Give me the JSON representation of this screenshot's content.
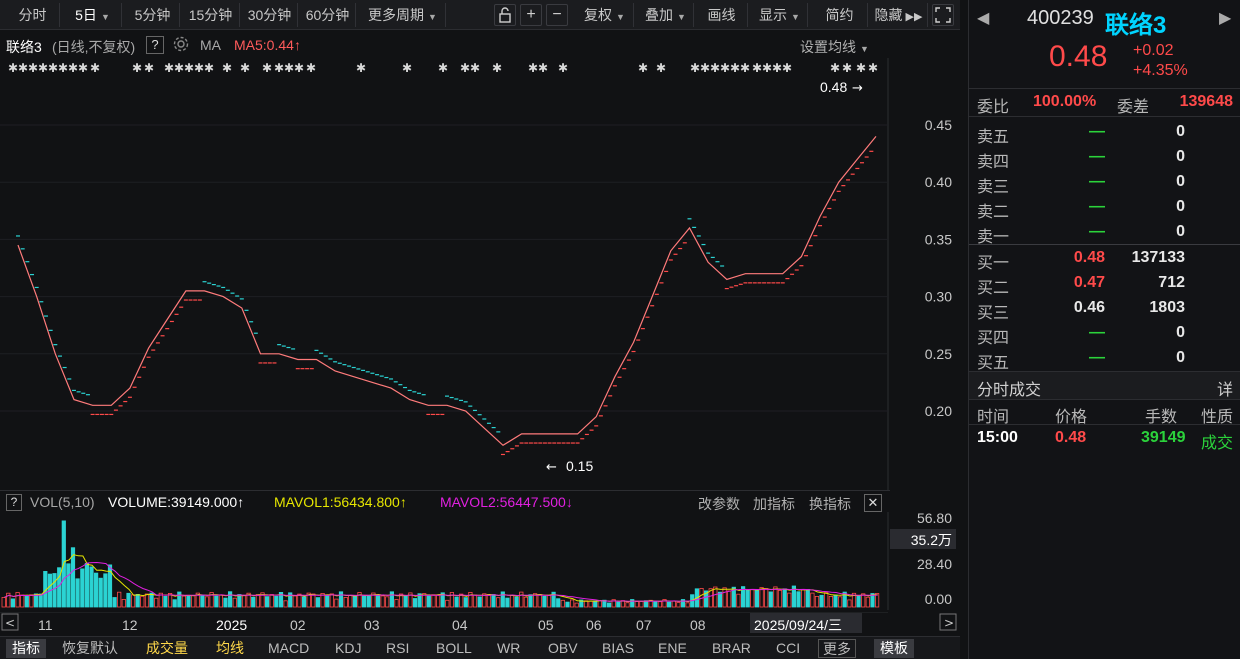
{
  "toolbar": {
    "period_buttons": [
      "分时",
      "5日",
      "5分钟",
      "15分钟",
      "30分钟",
      "60分钟",
      "更多周期"
    ],
    "tools": [
      "复权",
      "叠加",
      "画线",
      "显示",
      "简约",
      "隐藏"
    ]
  },
  "chart_header": {
    "name": "联络3",
    "mode": "(日线,不复权)",
    "help": "?",
    "ma_label": "MA",
    "ma5": "MA5:0.44",
    "settings": "设置均线"
  },
  "price_axis": [
    "0.45",
    "0.40",
    "0.35",
    "0.30",
    "0.25",
    "0.20"
  ],
  "annotations": {
    "high": "0.48",
    "low": "0.15"
  },
  "volume_header": {
    "help": "?",
    "vol": "VOL(5,10)",
    "volume": "VOLUME:39149.000",
    "mavol1": "MAVOL1:56434.800",
    "mavol2": "MAVOL2:56447.500",
    "edit_params": "改参数",
    "add_indicator": "加指标",
    "switch_indicator": "换指标"
  },
  "volume_axis": [
    "56.80",
    "35.2万",
    "28.40",
    "0.00"
  ],
  "time_axis": [
    "11",
    "12",
    "2025",
    "02",
    "03",
    "04",
    "05",
    "06",
    "07",
    "08",
    "2025/09/24/三"
  ],
  "bottom_tabs": [
    "指标",
    "恢复默认",
    "成交量",
    "均线",
    "MACD",
    "KDJ",
    "RSI",
    "BOLL",
    "WR",
    "OBV",
    "BIAS",
    "ENE",
    "BRAR",
    "CCI",
    "更多",
    "模板"
  ],
  "quote": {
    "code": "400239",
    "name": "联络3",
    "price": "0.48",
    "change": "+0.02",
    "change_pct": "+4.35%",
    "weibi_label": "委比",
    "weibi": "100.00%",
    "weicha_label": "委差",
    "weicha": "139648"
  },
  "order_book": {
    "asks": [
      {
        "label": "卖五",
        "price": "—",
        "vol": "0"
      },
      {
        "label": "卖四",
        "price": "—",
        "vol": "0"
      },
      {
        "label": "卖三",
        "price": "—",
        "vol": "0"
      },
      {
        "label": "卖二",
        "price": "—",
        "vol": "0"
      },
      {
        "label": "卖一",
        "price": "—",
        "vol": "0"
      }
    ],
    "bids": [
      {
        "label": "买一",
        "price": "0.48",
        "vol": "137133"
      },
      {
        "label": "买二",
        "price": "0.47",
        "vol": "712"
      },
      {
        "label": "买三",
        "price": "0.46",
        "vol": "1803"
      },
      {
        "label": "买四",
        "price": "—",
        "vol": "0"
      },
      {
        "label": "买五",
        "price": "—",
        "vol": "0"
      }
    ]
  },
  "trades": {
    "title": "分时成交",
    "detail": "详",
    "headers": [
      "时间",
      "价格",
      "手数",
      "性质"
    ],
    "rows": [
      {
        "time": "15:00",
        "price": "0.48",
        "vol": "39149",
        "type": "成交"
      }
    ]
  },
  "colors": {
    "up": "#ff4a4a",
    "down": "#2bd3d3",
    "ma5": "#ff7b7b",
    "mavol1": "#e6e600",
    "mavol2": "#e020e0",
    "accent": "#00d4ff"
  },
  "chart_data": {
    "type": "line",
    "x": [
      "10-28",
      "11-05",
      "11-12",
      "11-19",
      "11-26",
      "12-03",
      "12-10",
      "12-17",
      "12-24",
      "12-31",
      "01-07",
      "01-14",
      "01-21",
      "02-04",
      "02-11",
      "02-18",
      "02-25",
      "03-04",
      "03-11",
      "03-18",
      "03-25",
      "04-01",
      "04-08",
      "04-15",
      "04-22",
      "04-29",
      "05-07",
      "05-14",
      "05-21",
      "05-28",
      "06-04",
      "06-11",
      "06-18",
      "06-25",
      "07-02",
      "07-09",
      "07-16",
      "07-23",
      "07-30",
      "08-06",
      "08-13",
      "08-20",
      "08-27",
      "09-03",
      "09-10",
      "09-17",
      "09-24"
    ],
    "series": [
      {
        "name": "MA5",
        "values": [
          0.345,
          0.3,
          0.25,
          0.21,
          0.205,
          0.205,
          0.22,
          0.255,
          0.28,
          0.305,
          0.305,
          0.3,
          0.29,
          0.25,
          0.25,
          0.245,
          0.245,
          0.235,
          0.23,
          0.225,
          0.22,
          0.21,
          0.205,
          0.205,
          0.2,
          0.185,
          0.17,
          0.18,
          0.18,
          0.18,
          0.18,
          0.195,
          0.23,
          0.26,
          0.3,
          0.34,
          0.36,
          0.33,
          0.315,
          0.32,
          0.32,
          0.32,
          0.335,
          0.37,
          0.4,
          0.42,
          0.44
        ]
      }
    ],
    "ylim": [
      0.13,
      0.5
    ]
  }
}
